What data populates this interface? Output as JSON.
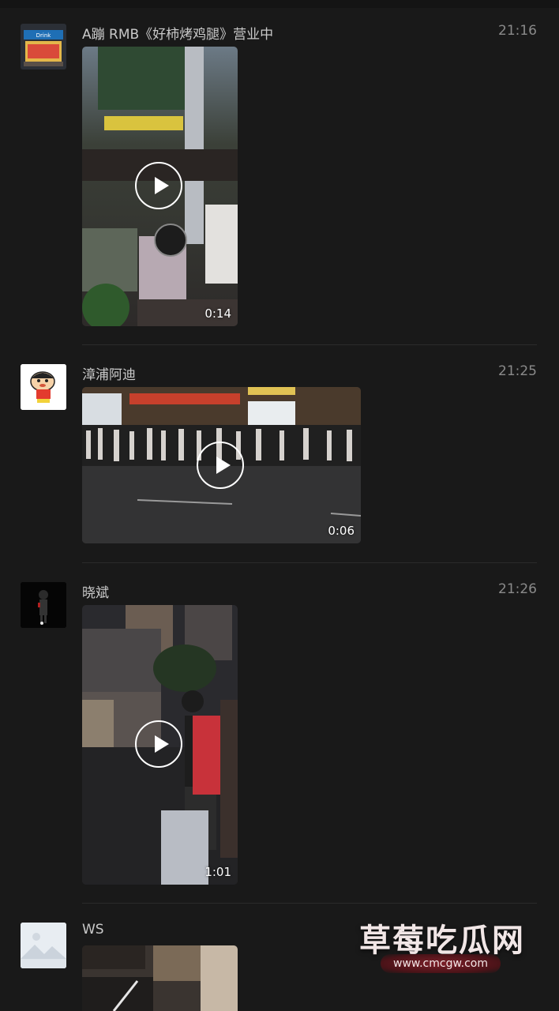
{
  "feed": {
    "posts": [
      {
        "name": "A蹦 RMB《好柿烤鸡腿》营业中",
        "time": "21:16",
        "duration": "0:14",
        "avatar_icon": "shop-storefront-icon"
      },
      {
        "name": "漳浦阿迪",
        "time": "21:25",
        "duration": "0:06",
        "avatar_icon": "cartoon-boy-icon"
      },
      {
        "name": "晓斌",
        "time": "21:26",
        "duration": "1:01",
        "avatar_icon": "dark-figure-icon"
      },
      {
        "name": "WS",
        "time": "",
        "duration": "",
        "avatar_icon": "mountain-placeholder-icon"
      }
    ]
  },
  "watermark": {
    "title": "草莓吃瓜网",
    "url": "www.cmcgw.com"
  },
  "colors": {
    "background": "#191919",
    "name_text": "#c9c9c9",
    "time_text": "#8a8a8a",
    "watermark_pill": "#7c1f28"
  }
}
